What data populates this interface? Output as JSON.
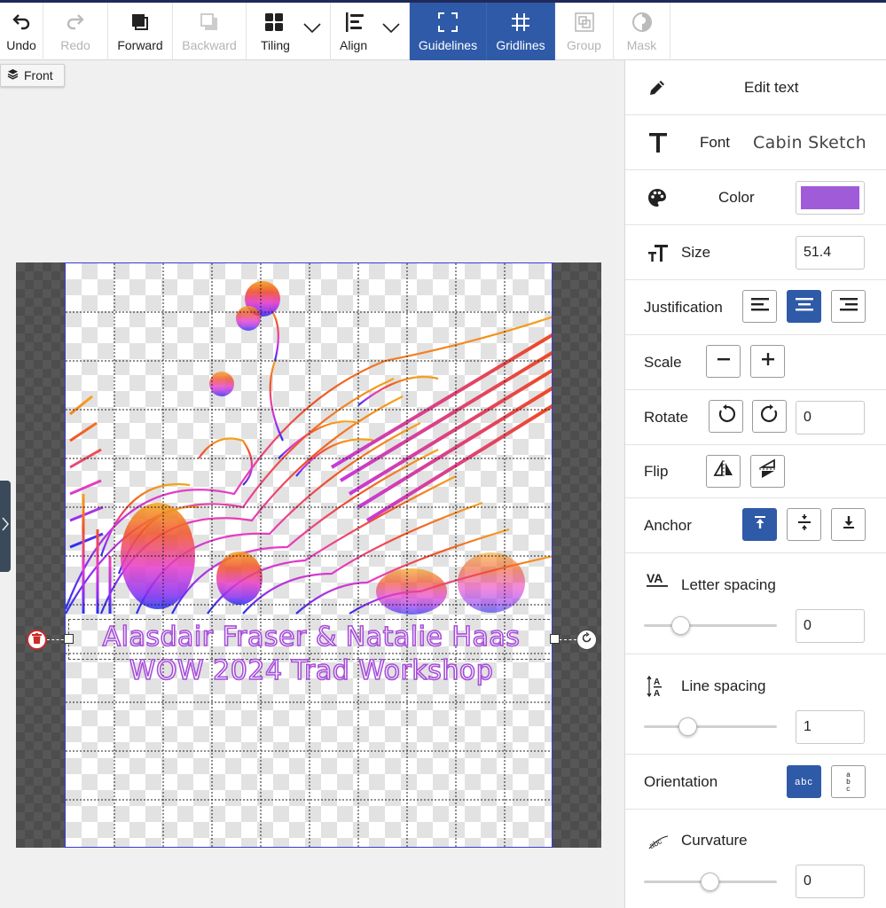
{
  "toolbar": {
    "undo": "Undo",
    "redo": "Redo",
    "forward": "Forward",
    "backward": "Backward",
    "tiling": "Tiling",
    "align": "Align",
    "guidelines": "Guidelines",
    "gridlines": "Gridlines",
    "group": "Group",
    "mask": "Mask"
  },
  "layer_tag": "Front",
  "canvas": {
    "text_line1": "Alasdair Fraser & Natalie Haas",
    "text_line2": "WOW 2024 Trad Workshop"
  },
  "panel": {
    "edit_text": "Edit text",
    "font_label": "Font",
    "font_value": "Cabin Sketch",
    "color_label": "Color",
    "color_value": "#a05bd8",
    "size_label": "Size",
    "size_value": "51.4",
    "justification_label": "Justification",
    "justification_selected": "center",
    "scale_label": "Scale",
    "rotate_label": "Rotate",
    "rotate_value": "0",
    "flip_label": "Flip",
    "anchor_label": "Anchor",
    "anchor_selected": "top",
    "letter_spacing_label": "Letter spacing",
    "letter_spacing_value": "0",
    "line_spacing_label": "Line spacing",
    "line_spacing_value": "1",
    "orientation_label": "Orientation",
    "orientation_horizontal": "abc",
    "orientation_selected": "horizontal",
    "curvature_label": "Curvature",
    "curvature_value": "0"
  },
  "colors": {
    "accent": "#2f5aa8",
    "text_color": "#a05bd8",
    "delete": "#c82b2b"
  }
}
